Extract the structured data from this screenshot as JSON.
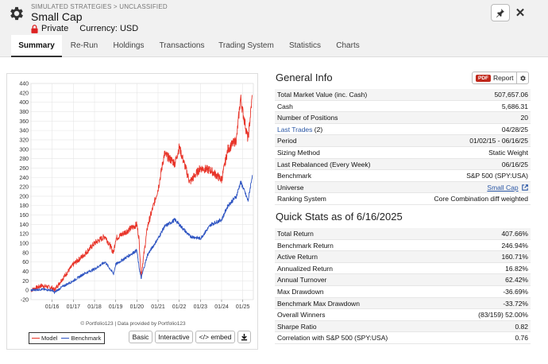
{
  "header": {
    "breadcrumb": "SIMULATED STRATEGIES > UNCLASSIFIED",
    "title": "Small Cap",
    "privacy": "Private",
    "currency": "Currency: USD"
  },
  "tabs": [
    "Summary",
    "Re-Run",
    "Holdings",
    "Transactions",
    "Trading System",
    "Statistics",
    "Charts"
  ],
  "general_info": {
    "title": "General Info",
    "report_label": "Report",
    "pdf_label": "PDF",
    "rows": [
      {
        "label": "Total Market Value (inc. Cash)",
        "value": "507,657.06"
      },
      {
        "label": "Cash",
        "value": "5,686.31"
      },
      {
        "label": "Number of Positions",
        "value": "20"
      },
      {
        "label": "Last Trades",
        "count": "(2)",
        "value": "04/28/25"
      },
      {
        "label": "Period",
        "value": "01/02/15 - 06/16/25"
      },
      {
        "label": "Sizing Method",
        "value": "Static Weight"
      },
      {
        "label": "Last Rebalanced (Every Week)",
        "value": "06/16/25"
      },
      {
        "label": "Benchmark",
        "value": "S&P 500 (SPY:USA)"
      },
      {
        "label": "Universe",
        "value": "Small Cap"
      },
      {
        "label": "Ranking System",
        "value": "Core Combination diff weighted"
      }
    ]
  },
  "quick_stats": {
    "title": "Quick Stats as of 6/16/2025",
    "rows": [
      {
        "label": "Total Return",
        "value": "407.66%"
      },
      {
        "label": "Benchmark Return",
        "value": "246.94%"
      },
      {
        "label": "Active Return",
        "value": "160.71%"
      },
      {
        "label": "Annualized Return",
        "value": "16.82%"
      },
      {
        "label": "Annual Turnover",
        "value": "62.42%"
      },
      {
        "label": "Max Drawdown",
        "value": "-36.69%"
      },
      {
        "label": "Benchmark Max Drawdown",
        "value": "-33.72%"
      },
      {
        "label": "Overall Winners",
        "value": "(83/159) 52.00%"
      },
      {
        "label": "Sharpe Ratio",
        "value": "0.82"
      },
      {
        "label": "Correlation with S&P 500 (SPY:USA)",
        "value": "0.76"
      }
    ]
  },
  "chart_buttons": {
    "basic": "Basic",
    "interactive": "Interactive",
    "embed": "</> embed"
  },
  "chart_credit": "© Portfolio123 | Data provided by Portfolio123",
  "colors": {
    "model": "#e8352a",
    "benchmark": "#2f55c2",
    "accent": "#2b57a5",
    "negative": "#cc2222"
  },
  "chart_data": {
    "type": "line",
    "ylim": [
      -20,
      440
    ],
    "yticks": [
      440,
      420,
      400,
      380,
      360,
      340,
      320,
      300,
      280,
      260,
      240,
      220,
      200,
      180,
      160,
      140,
      120,
      100,
      80,
      60,
      40,
      20,
      0,
      -20
    ],
    "xticks": [
      "01/16",
      "01/17",
      "01/18",
      "01/19",
      "01/20",
      "01/21",
      "01/22",
      "01/23",
      "01/24",
      "01/25"
    ],
    "x": [
      2015.0,
      2015.5,
      2016.0,
      2016.1,
      2016.5,
      2017.0,
      2017.5,
      2018.0,
      2018.5,
      2018.9,
      2019.0,
      2019.5,
      2020.0,
      2020.1,
      2020.2,
      2020.5,
      2021.0,
      2021.3,
      2021.8,
      2022.0,
      2022.5,
      2023.0,
      2023.5,
      2024.0,
      2024.3,
      2024.7,
      2024.9,
      2025.0,
      2025.25,
      2025.45
    ],
    "series": [
      {
        "name": "Model",
        "values": [
          0,
          10,
          5,
          0,
          25,
          55,
          75,
          100,
          115,
          80,
          110,
          125,
          140,
          110,
          30,
          135,
          215,
          290,
          270,
          305,
          230,
          260,
          255,
          235,
          300,
          320,
          410,
          380,
          320,
          415
        ]
      },
      {
        "name": "Benchmark",
        "values": [
          0,
          2,
          0,
          -5,
          8,
          20,
          35,
          45,
          60,
          35,
          55,
          70,
          85,
          50,
          25,
          75,
          110,
          135,
          150,
          140,
          115,
          110,
          140,
          150,
          180,
          200,
          230,
          220,
          190,
          245
        ]
      }
    ]
  }
}
